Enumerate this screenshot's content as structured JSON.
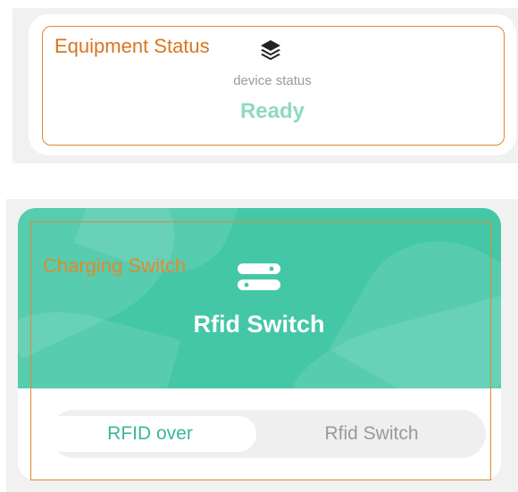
{
  "equipment_card": {
    "title": "Equipment Status",
    "icon": "layers-icon",
    "status_label": "device status",
    "status_value": "Ready"
  },
  "switch_card": {
    "overlay_title": "Charging Switch",
    "icon": "switch-icon",
    "title": "Rfid Switch",
    "options": [
      {
        "label": "RFID over",
        "selected": true
      },
      {
        "label": "Rfid Switch",
        "selected": false
      }
    ]
  },
  "colors": {
    "accent_orange": "#e08a2c",
    "banner_green": "#44c7a6",
    "ready_green": "#8fd9c4",
    "selected_text": "#3ab79a"
  }
}
